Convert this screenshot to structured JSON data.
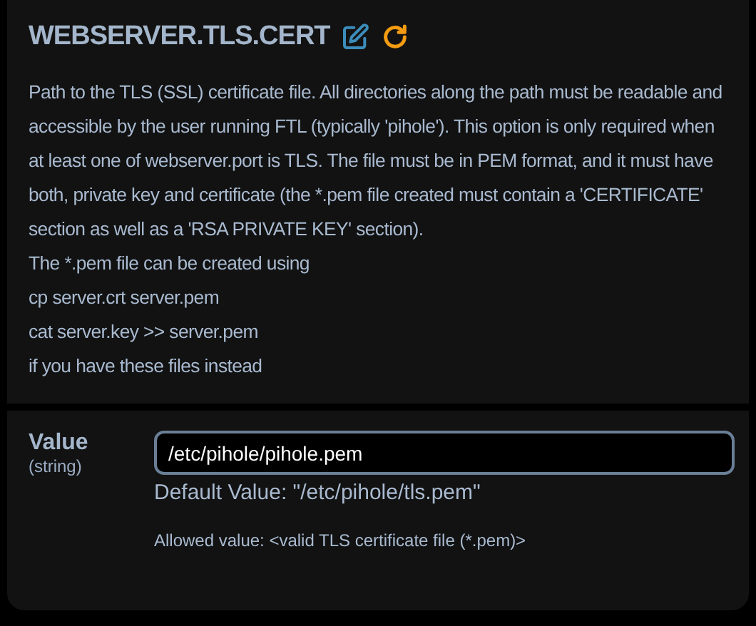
{
  "title": "WEBSERVER.TLS.CERT",
  "description": "Path to the TLS (SSL) certificate file. All directories along the path must be readable and accessible by the user running FTL (typically 'pihole'). This option is only required when at least one of webserver.port is TLS. The file must be in PEM format, and it must have both, private key and certificate (the *.pem file created must contain a 'CERTIFICATE' section as well as a 'RSA PRIVATE KEY' section).",
  "extra_lines": [
    "The *.pem file can be created using",
    "cp server.crt server.pem",
    "cat server.key >> server.pem",
    "if you have these files instead"
  ],
  "setting": {
    "label": "Value",
    "type": "(string)",
    "value": "/etc/pihole/pihole.pem",
    "default": "Default Value: \"/etc/pihole/tls.pem\"",
    "allowed": "Allowed value: <valid TLS certificate file (*.pem)>"
  }
}
